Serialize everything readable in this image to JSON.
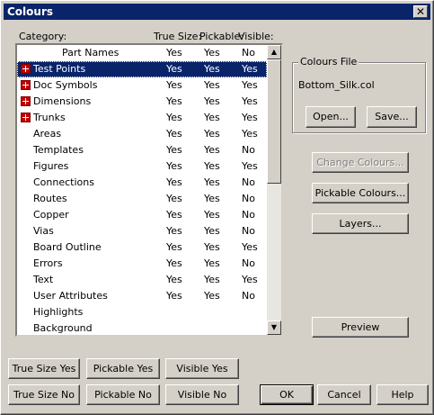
{
  "window": {
    "title": "Colours"
  },
  "list": {
    "headers": {
      "category": "Category:",
      "true_size": "True Size:",
      "pickable": "Pickable:",
      "visible": "Visible:"
    },
    "items": [
      {
        "name": "Part Names",
        "true_size": "Yes",
        "pickable": "Yes",
        "visible": "No",
        "expandable": false,
        "indent": 2
      },
      {
        "name": "Test Points",
        "true_size": "Yes",
        "pickable": "Yes",
        "visible": "Yes",
        "expandable": true,
        "selected": true
      },
      {
        "name": "Doc Symbols",
        "true_size": "Yes",
        "pickable": "Yes",
        "visible": "Yes",
        "expandable": true
      },
      {
        "name": "Dimensions",
        "true_size": "Yes",
        "pickable": "Yes",
        "visible": "Yes",
        "expandable": true
      },
      {
        "name": "Trunks",
        "true_size": "Yes",
        "pickable": "Yes",
        "visible": "Yes",
        "expandable": true
      },
      {
        "name": "Areas",
        "true_size": "Yes",
        "pickable": "Yes",
        "visible": "Yes"
      },
      {
        "name": "Templates",
        "true_size": "Yes",
        "pickable": "Yes",
        "visible": "No"
      },
      {
        "name": "Figures",
        "true_size": "Yes",
        "pickable": "Yes",
        "visible": "Yes"
      },
      {
        "name": "Connections",
        "true_size": "Yes",
        "pickable": "Yes",
        "visible": "No"
      },
      {
        "name": "Routes",
        "true_size": "Yes",
        "pickable": "Yes",
        "visible": "No"
      },
      {
        "name": "Copper",
        "true_size": "Yes",
        "pickable": "Yes",
        "visible": "No"
      },
      {
        "name": "Vias",
        "true_size": "Yes",
        "pickable": "Yes",
        "visible": "No"
      },
      {
        "name": "Board Outline",
        "true_size": "Yes",
        "pickable": "Yes",
        "visible": "Yes"
      },
      {
        "name": "Errors",
        "true_size": "Yes",
        "pickable": "Yes",
        "visible": "No"
      },
      {
        "name": "Text",
        "true_size": "Yes",
        "pickable": "Yes",
        "visible": "Yes"
      },
      {
        "name": "User Attributes",
        "true_size": "Yes",
        "pickable": "Yes",
        "visible": "No"
      },
      {
        "name": "Highlights",
        "true_size": "",
        "pickable": "",
        "visible": ""
      },
      {
        "name": "Background",
        "true_size": "",
        "pickable": "",
        "visible": ""
      }
    ]
  },
  "colours_file": {
    "group_label": "Colours File",
    "filename": "Bottom_Silk.col",
    "open_label": "Open...",
    "save_label": "Save..."
  },
  "buttons": {
    "change_colours": "Change Colours...",
    "pickable_colours": "Pickable Colours...",
    "layers": "Layers...",
    "preview": "Preview",
    "true_size_yes": "True Size Yes",
    "pickable_yes": "Pickable Yes",
    "visible_yes": "Visible Yes",
    "true_size_no": "True Size No",
    "pickable_no": "Pickable No",
    "visible_no": "Visible No",
    "ok": "OK",
    "cancel": "Cancel",
    "help": "Help"
  },
  "icons": {
    "close": "close-icon",
    "expand": "expand-plus-icon",
    "scroll_up": "scroll-up-arrow-icon",
    "scroll_down": "scroll-down-arrow-icon"
  },
  "colors": {
    "title_bar": "#0a246a",
    "selection": "#0a246a",
    "face": "#d4d0c8",
    "expand_icon": "#c00000"
  }
}
